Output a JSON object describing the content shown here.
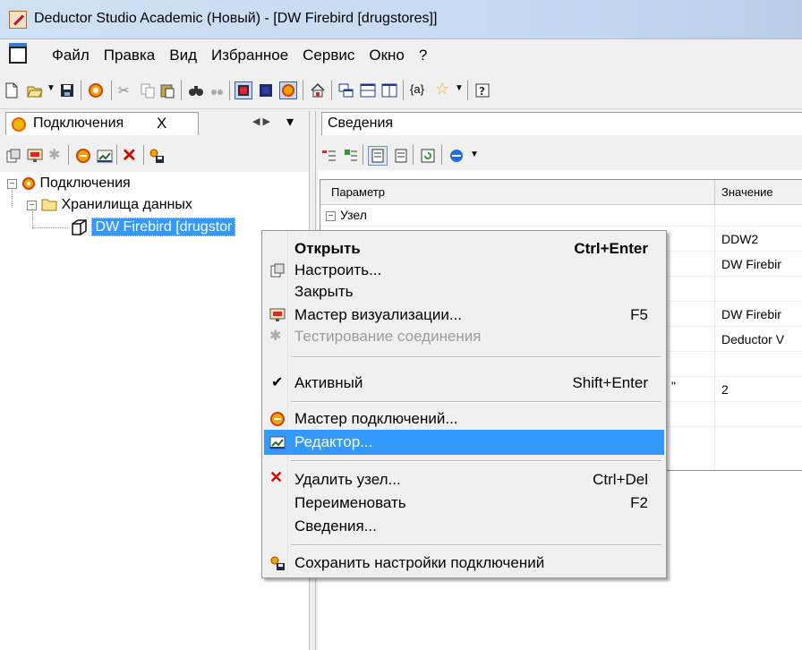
{
  "window": {
    "title": "Deductor Studio Academic (Новый) - [DW Firebird [drugstores]]"
  },
  "menubar": {
    "items": [
      "Файл",
      "Правка",
      "Вид",
      "Избранное",
      "Сервис",
      "Окно",
      "?"
    ]
  },
  "left_panel": {
    "tab_label": "Подключения",
    "tab_close": "X",
    "tree": {
      "root": "Подключения",
      "folder": "Хранилища данных",
      "selected_node": "DW Firebird [drugstor"
    }
  },
  "right_panel": {
    "tab_label": "Сведения",
    "grid": {
      "headers": [
        "Параметр",
        "Значение"
      ],
      "group_label": "Узел",
      "rows": [
        {
          "param": "",
          "value": ""
        },
        {
          "param": "",
          "value": "DDW2"
        },
        {
          "param": "",
          "value": "DW Firebir"
        },
        {
          "param": "",
          "value": ""
        },
        {
          "param": "",
          "value": "DW Firebir"
        },
        {
          "param": "",
          "value": "Deductor V"
        },
        {
          "param": "",
          "value": ""
        },
        {
          "param": "\"",
          "value": "2"
        }
      ]
    }
  },
  "context_menu": {
    "items": [
      {
        "label": "Открыть",
        "shortcut": "Ctrl+Enter",
        "bold": true,
        "icon": ""
      },
      {
        "label": "Настроить...",
        "shortcut": "",
        "icon": "settings-icon"
      },
      {
        "label": "Закрыть",
        "shortcut": "",
        "icon": ""
      },
      {
        "label": "Мастер визуализации...",
        "shortcut": "F5",
        "icon": "visualization-wizard-icon"
      },
      {
        "label": "Тестирование соединения",
        "shortcut": "",
        "disabled": true,
        "icon": "test-connection-icon"
      },
      {
        "label": "Активный",
        "shortcut": "Shift+Enter",
        "checked": true,
        "icon": "checkmark-icon"
      },
      {
        "label": "Мастер подключений...",
        "shortcut": "",
        "icon": "connection-wizard-icon"
      },
      {
        "label": "Редактор...",
        "shortcut": "",
        "highlighted": true,
        "icon": "editor-icon"
      },
      {
        "label": "Удалить узел...",
        "shortcut": "Ctrl+Del",
        "icon": "delete-icon"
      },
      {
        "label": "Переименовать",
        "shortcut": "F2",
        "icon": ""
      },
      {
        "label": "Сведения...",
        "shortcut": "",
        "icon": ""
      },
      {
        "label": "Сохранить настройки подключений",
        "shortcut": "",
        "icon": "save-settings-icon"
      }
    ]
  },
  "colors": {
    "highlight": "#3399ff",
    "selected_tree": "#3399ff",
    "delete_red": "#d40000"
  }
}
